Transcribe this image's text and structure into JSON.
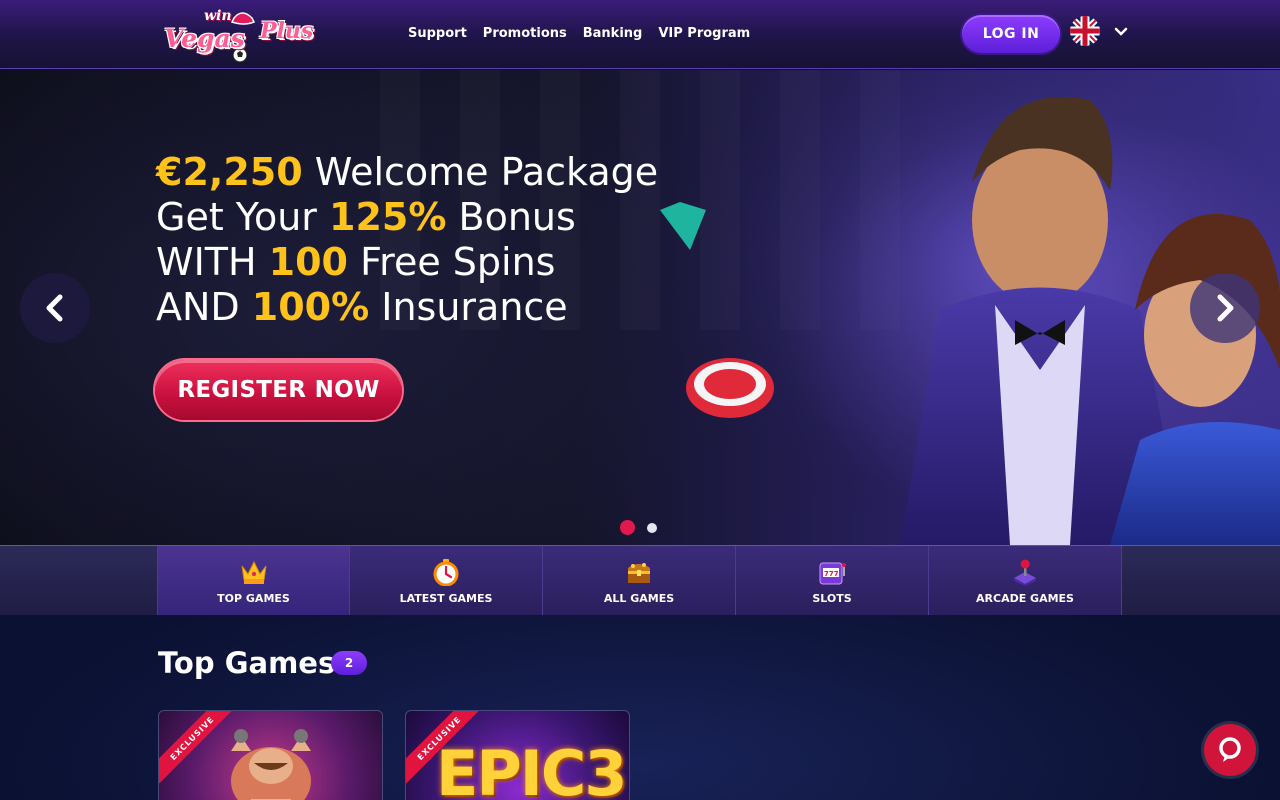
{
  "brand": {
    "logo_text_top": "win",
    "logo_text_main": "Vegas",
    "logo_text_tail": "Plus"
  },
  "nav": {
    "items": [
      {
        "label": "Support"
      },
      {
        "label": "Promotions"
      },
      {
        "label": "Banking"
      },
      {
        "label": "VIP Program"
      }
    ]
  },
  "header": {
    "login_label": "LOG IN",
    "language_icon": "uk-flag-icon"
  },
  "hero": {
    "lines": [
      {
        "hl": "€2,250",
        "rest": " Welcome Package",
        "order": "hl-first"
      },
      {
        "pre": "Get Your ",
        "hl": "125%",
        "post": " Bonus"
      },
      {
        "pre": "WITH ",
        "hl": "100",
        "post": " Free Spins"
      },
      {
        "pre": "AND ",
        "hl": "100%",
        "post": " Insurance"
      }
    ],
    "cta_label": "REGISTER NOW",
    "slides_total": 2,
    "slide_active": 1
  },
  "tabs": [
    {
      "label": "TOP GAMES",
      "icon": "crown-icon",
      "active": true
    },
    {
      "label": "LATEST GAMES",
      "icon": "stopwatch-icon",
      "active": false
    },
    {
      "label": "ALL GAMES",
      "icon": "treasure-chest-icon",
      "active": false
    },
    {
      "label": "SLOTS",
      "icon": "slot-machine-icon",
      "active": false
    },
    {
      "label": "ARCADE GAMES",
      "icon": "joystick-icon",
      "active": false
    }
  ],
  "section": {
    "title": "Top Games",
    "count": "2"
  },
  "games": [
    {
      "ribbon": "EXCLUSIVE",
      "title": ""
    },
    {
      "ribbon": "EXCLUSIVE",
      "title": "EPIC3"
    }
  ],
  "colors": {
    "accent_yellow": "#ffc21a",
    "cta_red": "#d1143a",
    "login_purple": "#6a2ae8"
  }
}
